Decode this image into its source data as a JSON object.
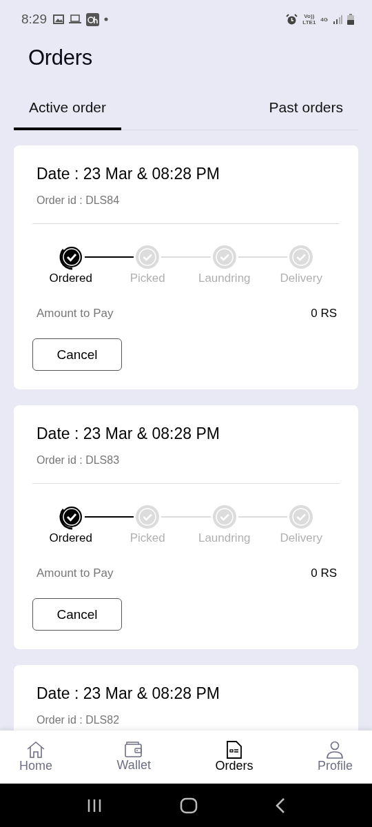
{
  "status_bar": {
    "time": "8:29",
    "network": "Vo))",
    "network_sub": "LTE1",
    "data": "4G"
  },
  "title": "Orders",
  "tabs": [
    {
      "label": "Active order",
      "selected": true
    },
    {
      "label": "Past orders",
      "selected": false
    }
  ],
  "orders": [
    {
      "date": "Date : 23 Mar & 08:28 PM",
      "order_id": "Order id : DLS84",
      "steps": [
        {
          "label": "Ordered",
          "done": true
        },
        {
          "label": "Picked",
          "done": false
        },
        {
          "label": "Laundring",
          "done": false
        },
        {
          "label": "Delivery",
          "done": false
        }
      ],
      "amount_label": "Amount to Pay",
      "amount": "0 RS",
      "button": "Cancel"
    },
    {
      "date": "Date : 23 Mar & 08:28 PM",
      "order_id": "Order id : DLS83",
      "steps": [
        {
          "label": "Ordered",
          "done": true
        },
        {
          "label": "Picked",
          "done": false
        },
        {
          "label": "Laundring",
          "done": false
        },
        {
          "label": "Delivery",
          "done": false
        }
      ],
      "amount_label": "Amount to Pay",
      "amount": "0 RS",
      "button": "Cancel"
    },
    {
      "date": "Date : 23 Mar & 08:28 PM",
      "order_id": "Order id : DLS82"
    }
  ],
  "nav": [
    {
      "label": "Home",
      "kind": "home",
      "selected": false
    },
    {
      "label": "Wallet",
      "kind": "wallet",
      "selected": false
    },
    {
      "label": "Orders",
      "kind": "orders",
      "selected": true
    },
    {
      "label": "Profile",
      "kind": "profile",
      "selected": false
    }
  ]
}
